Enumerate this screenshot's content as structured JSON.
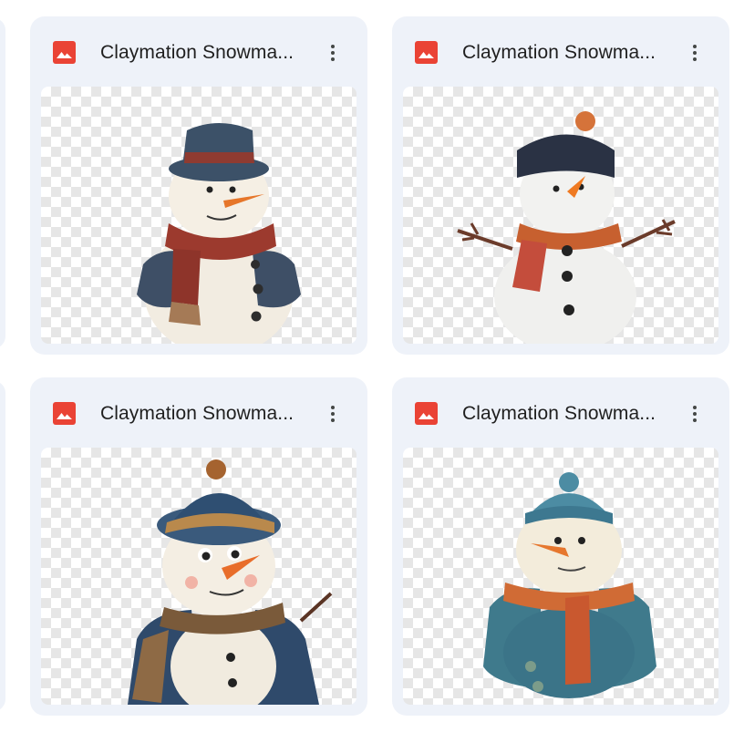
{
  "files": [
    {
      "name": "Claymation Snowma...",
      "type_icon": "image-file-icon",
      "menu_icon": "more-vert-icon"
    },
    {
      "name": "Claymation Snowma...",
      "type_icon": "image-file-icon",
      "menu_icon": "more-vert-icon"
    },
    {
      "name": "Claymation Snowma...",
      "type_icon": "image-file-icon",
      "menu_icon": "more-vert-icon"
    },
    {
      "name": "Claymation Snowma...",
      "type_icon": "image-file-icon",
      "menu_icon": "more-vert-icon"
    }
  ],
  "colors": {
    "card_bg": "#eef2f9",
    "image_icon": "#ea4335",
    "title_text": "#1f1f1f"
  }
}
